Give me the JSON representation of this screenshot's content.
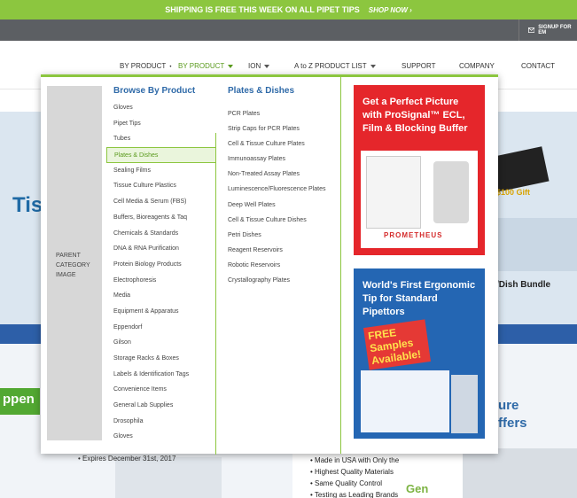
{
  "promo": {
    "message": "SHIPPING IS FREE THIS WEEK ON ALL PIPET TIPS",
    "link": "SHOP NOW ›"
  },
  "utility": {
    "signup": "SIGNUP FOR EM"
  },
  "nav": {
    "items": [
      {
        "label": "BY PRODUCT"
      },
      {
        "label": "BY PRODUCT"
      },
      {
        "label": "ION"
      },
      {
        "label": "A to Z PRODUCT LIST"
      },
      {
        "label": "SUPPORT"
      },
      {
        "label": "COMPANY"
      },
      {
        "label": "CONTACT"
      }
    ]
  },
  "background": {
    "hero_word": "Tis",
    "bundle_text": "/Dish Bundle",
    "gift_text": "$100 Gift",
    "pp_text": "ppen",
    "ure_text": "ure\nffers",
    "expires": "• Expires December 31st, 2017",
    "bullets": [
      "• Made in USA with Only the",
      "• Highest Quality Materials",
      "• Same Quality Control",
      "• Testing as Leading Brands"
    ],
    "gen_text": "Gen"
  },
  "menu": {
    "parent_image_label": "PARENT CATEGORY IMAGE",
    "browse_title": "Browse By Product",
    "categories": [
      "Gloves",
      "Pipet Tips",
      "Tubes",
      "Plates & Dishes",
      "Sealing Films",
      "Tissue Culture Plastics",
      "Cell Media & Serum (FBS)",
      "Buffers, Bioreagents & Taq",
      "Chemicals & Standards",
      "DNA & RNA Purification",
      "Protein Biology Products",
      "Electrophoresis",
      "Media",
      "Equipment & Apparatus",
      "Eppendorf",
      "Gilson",
      "Storage Racks & Boxes",
      "Labels & Identification Tags",
      "Convenience Items",
      "General Lab Supplies",
      "Drosophila",
      "Gloves"
    ],
    "selected_category": "Plates & Dishes",
    "sub_title": "Plates & Dishes",
    "subcategories": [
      "PCR Plates",
      "Strip Caps for PCR Plates",
      "Cell & Tissue Culture Plates",
      "Immunoassay Plates",
      "Non-Treated Assay Plates",
      "Luminescence/Fluorescence Plates",
      "Deep Well Plates",
      "Cell & Tissue Culture Dishes",
      "Petri Dishes",
      "Reagent Reservoirs",
      "Robotic Reservoirs",
      "Crystallography Plates"
    ]
  },
  "ads": {
    "ad1": {
      "headline": "Get a Perfect Picture with ProSignal™ ECL, Film & Blocking Buffer",
      "logo": "PROMETHEUS",
      "color": "#e5262b"
    },
    "ad2": {
      "headline": "World's First Ergonomic Tip for Standard Pipettors",
      "badge": "FREE Samples Available!",
      "color": "#2466b3"
    }
  },
  "colors": {
    "accent_green": "#8cc63f",
    "title_blue": "#2f6aa8",
    "utility_grey": "#5c5f63"
  }
}
